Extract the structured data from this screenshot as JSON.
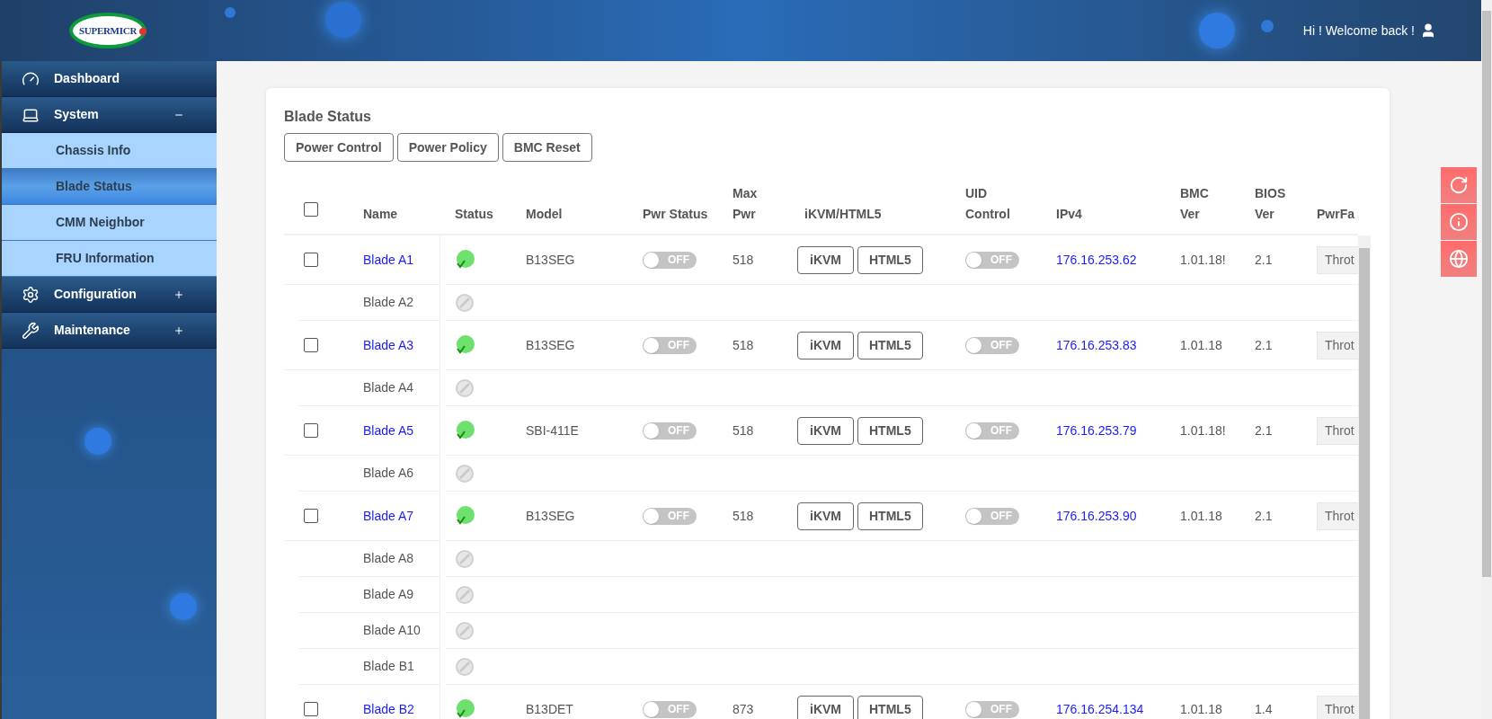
{
  "header": {
    "logo": "SUPERMICR",
    "greeting": "Hi ! Welcome back !"
  },
  "sidebar": {
    "items": [
      {
        "label": "Dashboard",
        "kind": "top",
        "selected": false
      },
      {
        "label": "System",
        "kind": "group",
        "expanded": true,
        "children": [
          {
            "label": "Chassis Info",
            "selected": false
          },
          {
            "label": "Blade Status",
            "selected": true
          },
          {
            "label": "CMM Neighbor",
            "selected": false
          },
          {
            "label": "FRU Information",
            "selected": false
          }
        ]
      },
      {
        "label": "Configuration",
        "kind": "group",
        "expanded": false
      },
      {
        "label": "Maintenance",
        "kind": "group",
        "expanded": false
      }
    ]
  },
  "card": {
    "title": "Blade Status",
    "actions": [
      "Power Control",
      "Power Policy",
      "BMC Reset"
    ]
  },
  "table": {
    "select_all": false,
    "columns": [
      [
        "Name"
      ],
      [
        "Status"
      ],
      [
        "Model"
      ],
      [
        "Pwr Status"
      ],
      [
        "Max",
        "Pwr"
      ],
      [
        "iKVM/HTML5"
      ],
      [
        "UID",
        "Control"
      ],
      [
        "IPv4"
      ],
      [
        "BMC",
        "Ver"
      ],
      [
        "BIOS",
        "Ver"
      ],
      [
        "PwrFa"
      ]
    ],
    "rows": [
      {
        "kind": "blade",
        "name": "Blade A1",
        "checked": false,
        "online": true,
        "model": "B13SEG",
        "pwr_status": {
          "label": "OFF",
          "on": false
        },
        "max_pwr": "518",
        "ikvm": "iKVM",
        "html5": "HTML5",
        "uid": {
          "label": "OFF",
          "on": false
        },
        "ipv4": "176.16.253.62",
        "bmc_ver": "1.01.18!",
        "bios_ver": "2.1",
        "pwr_fail": "Throt"
      },
      {
        "kind": "empty",
        "name": "Blade A2",
        "online": false
      },
      {
        "kind": "blade",
        "name": "Blade A3",
        "checked": false,
        "online": true,
        "model": "B13SEG",
        "pwr_status": {
          "label": "OFF",
          "on": false
        },
        "max_pwr": "518",
        "ikvm": "iKVM",
        "html5": "HTML5",
        "uid": {
          "label": "OFF",
          "on": false
        },
        "ipv4": "176.16.253.83",
        "bmc_ver": "1.01.18",
        "bios_ver": "2.1",
        "pwr_fail": "Throt"
      },
      {
        "kind": "empty",
        "name": "Blade A4",
        "online": false
      },
      {
        "kind": "blade",
        "name": "Blade A5",
        "checked": false,
        "online": true,
        "model": "SBI-411E",
        "pwr_status": {
          "label": "OFF",
          "on": false
        },
        "max_pwr": "518",
        "ikvm": "iKVM",
        "html5": "HTML5",
        "uid": {
          "label": "OFF",
          "on": false
        },
        "ipv4": "176.16.253.79",
        "bmc_ver": "1.01.18!",
        "bios_ver": "2.1",
        "pwr_fail": "Throt"
      },
      {
        "kind": "empty",
        "name": "Blade A6",
        "online": false
      },
      {
        "kind": "blade",
        "name": "Blade A7",
        "checked": false,
        "online": true,
        "model": "B13SEG",
        "pwr_status": {
          "label": "OFF",
          "on": false
        },
        "max_pwr": "518",
        "ikvm": "iKVM",
        "html5": "HTML5",
        "uid": {
          "label": "OFF",
          "on": false
        },
        "ipv4": "176.16.253.90",
        "bmc_ver": "1.01.18",
        "bios_ver": "2.1",
        "pwr_fail": "Throt"
      },
      {
        "kind": "empty",
        "name": "Blade A8",
        "online": false
      },
      {
        "kind": "empty",
        "name": "Blade A9",
        "online": false
      },
      {
        "kind": "empty",
        "name": "Blade A10",
        "online": false
      },
      {
        "kind": "empty",
        "name": "Blade B1",
        "online": false
      },
      {
        "kind": "blade",
        "name": "Blade B2",
        "checked": false,
        "online": true,
        "model": "B13DET",
        "pwr_status": {
          "label": "OFF",
          "on": false
        },
        "max_pwr": "873",
        "ikvm": "iKVM",
        "html5": "HTML5",
        "uid": {
          "label": "OFF",
          "on": false
        },
        "ipv4": "176.16.254.134",
        "bmc_ver": "1.01.18",
        "bios_ver": "1.4",
        "pwr_fail": "Throt"
      }
    ]
  }
}
